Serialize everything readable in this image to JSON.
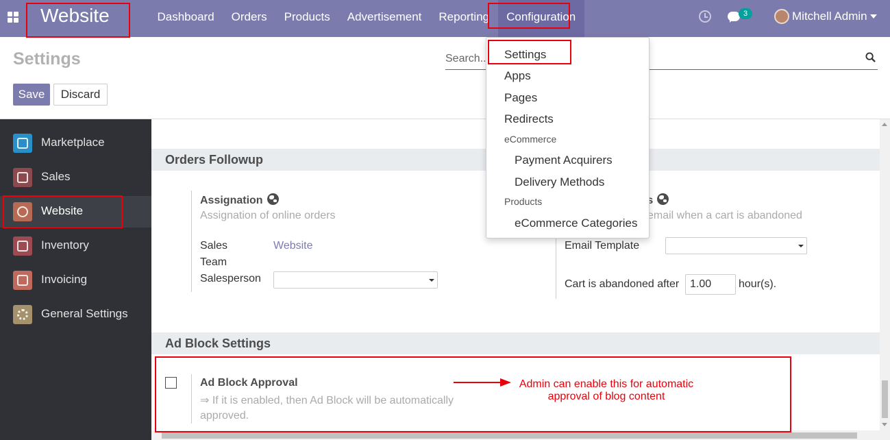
{
  "navbar": {
    "brand": "Website",
    "menu": [
      "Dashboard",
      "Orders",
      "Products",
      "Advertisement",
      "Reporting",
      "Configuration"
    ],
    "active_menu": "Configuration",
    "chat_count": "3",
    "user_name": "Mitchell Admin"
  },
  "control_panel": {
    "title": "Settings",
    "search_placeholder": "Search...",
    "save_label": "Save",
    "discard_label": "Discard"
  },
  "sidebar": {
    "items": [
      {
        "label": "Marketplace",
        "color": "#2a8ec8",
        "icon": "marketplace-icon"
      },
      {
        "label": "Sales",
        "color": "#8c4a4e",
        "icon": "sales-icon"
      },
      {
        "label": "Website",
        "color": "#b86b54",
        "icon": "website-icon"
      },
      {
        "label": "Inventory",
        "color": "#9d4b52",
        "icon": "inventory-icon"
      },
      {
        "label": "Invoicing",
        "color": "#c0695d",
        "icon": "invoicing-icon"
      },
      {
        "label": "General Settings",
        "color": "#a5916b",
        "icon": "gear-icon"
      }
    ],
    "active": "Website"
  },
  "config_dropdown": {
    "items": [
      "Settings",
      "Apps",
      "Pages",
      "Redirects"
    ],
    "ecommerce_header": "eCommerce",
    "ecommerce_items": [
      "Payment Acquirers",
      "Delivery Methods"
    ],
    "products_header": "Products",
    "products_items": [
      "eCommerce Categories"
    ]
  },
  "orders_followup": {
    "title": "Orders Followup",
    "assignation": {
      "title": "Assignation",
      "desc": "Assignation of online orders",
      "sales_team_label_1": "Sales",
      "sales_team_label_2": "Team",
      "sales_team_value": "Website",
      "salesperson_label": "Salesperson"
    },
    "abandoned": {
      "title_visible": "ts",
      "desc_visible": "email when a cart is abandoned",
      "email_template_label": "Email Template",
      "cart_abandoned_label": "Cart is abandoned after",
      "cart_abandoned_value": "1.00",
      "cart_abandoned_unit": "hour(s)."
    }
  },
  "ad_block": {
    "title": "Ad Block Settings",
    "approval_title": "Ad Block Approval",
    "approval_desc_1": "⇒ If it is enabled, then Ad Block will be automatically",
    "approval_desc_2": "approved.",
    "checked": false
  },
  "annotation": {
    "line_1": "Admin can enable this for automatic",
    "line_2": "approval of blog content",
    "color": "#e8000b"
  }
}
